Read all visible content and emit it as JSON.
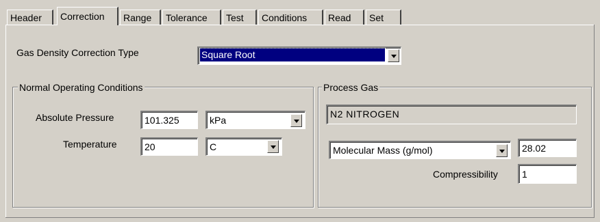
{
  "tabs": [
    "Header",
    "Correction",
    "Range",
    "Tolerance",
    "Test",
    "Conditions",
    "Read",
    "Set"
  ],
  "active_tab": "Correction",
  "gas_density": {
    "label": "Gas Density Correction Type",
    "value": "Square Root"
  },
  "normal_conditions": {
    "title": "Normal Operating Conditions",
    "pressure_label": "Absolute Pressure",
    "pressure_value": "101.325",
    "pressure_unit": "kPa",
    "temperature_label": "Temperature",
    "temperature_value": "20",
    "temperature_unit": "C"
  },
  "process_gas": {
    "title": "Process Gas",
    "gas_name": "N2  NITROGEN",
    "property_select": "Molecular Mass (g/mol)",
    "property_value": "28.02",
    "compressibility_label": "Compressibility",
    "compressibility_value": "1"
  },
  "colors": {
    "selection": "#000080",
    "face": "#d4d0c8"
  }
}
